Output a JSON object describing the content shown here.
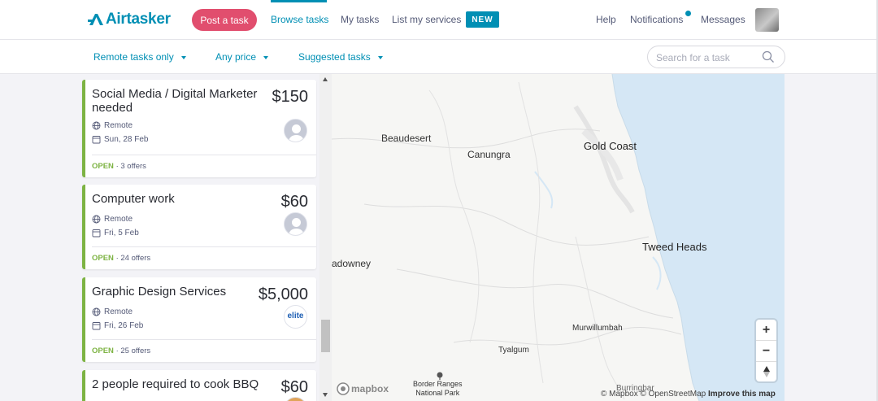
{
  "nav": {
    "logo_text": "Airtasker",
    "post_task": "Post a task",
    "browse_tasks": "Browse tasks",
    "my_tasks": "My tasks",
    "list_services": "List my services",
    "new_badge": "NEW",
    "help": "Help",
    "notifications": "Notifications",
    "messages": "Messages"
  },
  "filters": {
    "remote": "Remote tasks only",
    "price": "Any price",
    "suggested": "Suggested tasks",
    "search_placeholder": "Search for a task"
  },
  "tasks": [
    {
      "title": "Social Media / Digital Marketer needed",
      "price": "$150",
      "location": "Remote",
      "date": "Sun, 28 Feb",
      "status": "OPEN",
      "offers": " · 3 offers",
      "avatar": "default"
    },
    {
      "title": "Computer work",
      "price": "$60",
      "location": "Remote",
      "date": "Fri, 5 Feb",
      "status": "OPEN",
      "offers": " · 24 offers",
      "avatar": "default"
    },
    {
      "title": "Graphic Design Services",
      "price": "$5,000",
      "location": "Remote",
      "date": "Fri, 26 Feb",
      "status": "OPEN",
      "offers": " · 25 offers",
      "avatar": "elite",
      "avatar_text": "elite"
    },
    {
      "title": "2 people required to cook BBQ",
      "price": "$60",
      "location": "",
      "date": "",
      "status": "",
      "offers": "",
      "avatar": "photo"
    }
  ],
  "map": {
    "places": {
      "beaudesert": "Beaudesert",
      "canungra": "Canungra",
      "gold_coast": "Gold Coast",
      "tweed_heads": "Tweed Heads",
      "adowney": "adowney",
      "murwillumbah": "Murwillumbah",
      "tyalgum": "Tyalgum",
      "border_ranges_1": "Border Ranges",
      "border_ranges_2": "National Park",
      "burringbar": "Burringbar"
    },
    "zoom_in": "+",
    "zoom_out": "−",
    "logo": "mapbox",
    "attribution_1": "© Mapbox © OpenStreetMap",
    "attribution_2": "Improve this map"
  },
  "colors": {
    "brand": "#008fb4",
    "post_button": "#e14e6e",
    "open_status": "#7db343",
    "ocean": "#d5e7f5"
  }
}
